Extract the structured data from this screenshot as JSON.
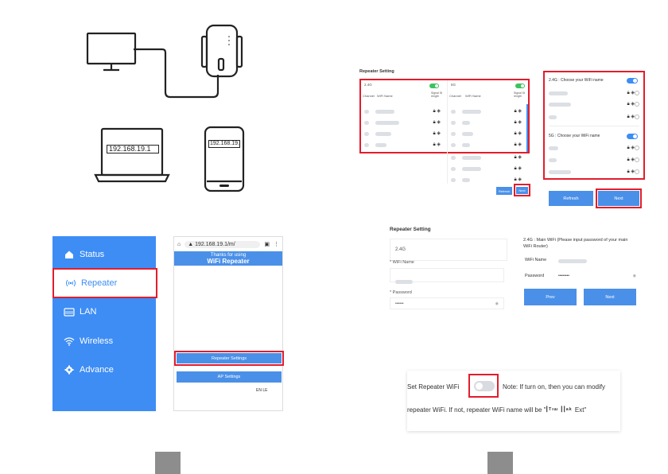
{
  "ip_laptop": "192.168.19.1",
  "ip_phone": "192.168.19.1",
  "sidebar": {
    "status": "Status",
    "repeater": "Repeater",
    "lan": "LAN",
    "wireless": "Wireless",
    "advance": "Advance"
  },
  "browser": {
    "url": "192.168.19.1/m/",
    "thanks": "Thanks for using",
    "product": "WiFi Repeater",
    "repeater_btn": "Repeater Settings",
    "ap_btn": "AP Settings",
    "lang": "EN  LE"
  },
  "rs1": {
    "title": "Repeater Setting",
    "band1": "2.4G",
    "band2": "5G",
    "col_channel": "Channel",
    "col_wifi": "WiFi Name",
    "col_signal": "Signal St rength",
    "refresh": "Refresh",
    "next": "Next"
  },
  "choose": {
    "g24": "2.4G : Choose your WiFi name",
    "g5": "5G : Choose your WiFi name",
    "refresh": "Refresh",
    "next": "Next"
  },
  "rs2": {
    "title": "Repeater Setting",
    "band": "2.4G",
    "wifi_name": "* WiFi Name",
    "password": "* Password",
    "pwd_value": "••••••"
  },
  "mainwifi": {
    "heading": "2.4G : Main WiFi (Please input password of your main WiFi Router)",
    "wifi_name": "WiFi Name",
    "password": "Password",
    "pwd_value": "••••••••",
    "prev": "Prev",
    "next": "Next"
  },
  "setwifi": {
    "label": "Set Repeater WiFi",
    "note1": "Note: If turn on, then you can modify",
    "note2": "repeater WiFi. If not, repeater WiFi name will be \"",
    "note_end": "Ext\""
  },
  "colors": {
    "accent": "#3d8df5",
    "highlight": "#e21d2c",
    "toggle_on": "#3cc35f",
    "page_box": "#8d8d8d"
  }
}
